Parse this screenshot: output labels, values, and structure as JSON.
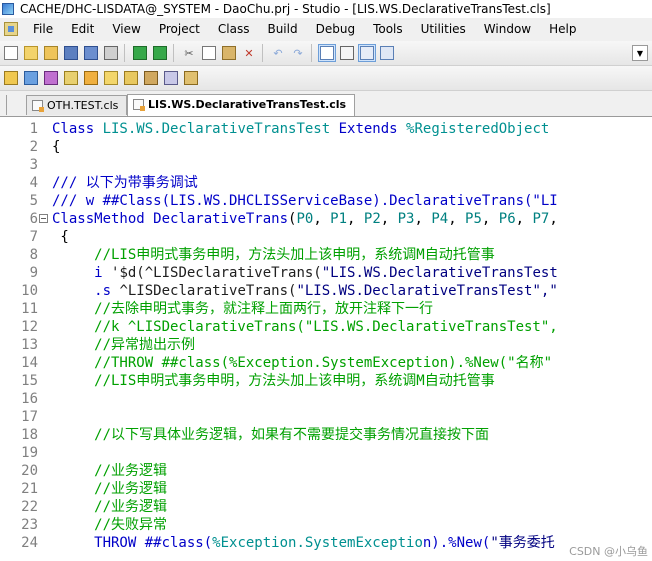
{
  "window": {
    "title": "CACHE/DHC-LISDATA@_SYSTEM - DaoChu.prj - Studio - [LIS.WS.DeclarativeTransTest.cls]"
  },
  "menu": [
    "File",
    "Edit",
    "View",
    "Project",
    "Class",
    "Build",
    "Debug",
    "Tools",
    "Utilities",
    "Window",
    "Help"
  ],
  "tabs": [
    {
      "label": "OTH.TEST.cls",
      "active": false
    },
    {
      "label": "LIS.WS.DeclarativeTransTest.cls",
      "active": true
    }
  ],
  "editor": {
    "lines": [
      {
        "n": "1",
        "fold": false,
        "segs": [
          {
            "t": "Class ",
            "c": "kw"
          },
          {
            "t": "LIS.WS.DeclarativeTransTest ",
            "c": "cls"
          },
          {
            "t": "Extends ",
            "c": "kw"
          },
          {
            "t": "%RegisteredObject",
            "c": "cls"
          }
        ]
      },
      {
        "n": "2",
        "fold": false,
        "segs": [
          {
            "t": "{",
            "c": "bl"
          }
        ]
      },
      {
        "n": "3",
        "fold": false,
        "segs": []
      },
      {
        "n": "4",
        "fold": false,
        "segs": [
          {
            "t": "/// 以下为带事务调试",
            "c": "kw"
          }
        ]
      },
      {
        "n": "5",
        "fold": false,
        "segs": [
          {
            "t": "/// w ##Class(LIS.WS.DHCLISServiceBase).DeclarativeTrans(\"LI",
            "c": "kw"
          }
        ]
      },
      {
        "n": "6",
        "fold": true,
        "segs": [
          {
            "t": "ClassMethod ",
            "c": "kw"
          },
          {
            "t": "DeclarativeTrans",
            "c": "kw"
          },
          {
            "t": "(",
            "c": "bl"
          },
          {
            "t": "P0",
            "c": "par"
          },
          {
            "t": ", ",
            "c": "bl"
          },
          {
            "t": "P1",
            "c": "par"
          },
          {
            "t": ", ",
            "c": "bl"
          },
          {
            "t": "P2",
            "c": "par"
          },
          {
            "t": ", ",
            "c": "bl"
          },
          {
            "t": "P3",
            "c": "par"
          },
          {
            "t": ", ",
            "c": "bl"
          },
          {
            "t": "P4",
            "c": "par"
          },
          {
            "t": ", ",
            "c": "bl"
          },
          {
            "t": "P5",
            "c": "par"
          },
          {
            "t": ", ",
            "c": "bl"
          },
          {
            "t": "P6",
            "c": "par"
          },
          {
            "t": ", ",
            "c": "bl"
          },
          {
            "t": "P7",
            "c": "par"
          },
          {
            "t": ",",
            "c": "bl"
          }
        ]
      },
      {
        "n": "7",
        "fold": false,
        "segs": [
          {
            "t": " {",
            "c": "bl"
          }
        ]
      },
      {
        "n": "8",
        "fold": false,
        "segs": [
          {
            "t": "     //LIS申明式事务申明，方法头加上该申明，系统调M自动托管事",
            "c": "cm"
          }
        ]
      },
      {
        "n": "9",
        "fold": false,
        "segs": [
          {
            "t": "     i ",
            "c": "kw"
          },
          {
            "t": "'$d(",
            "c": "dk"
          },
          {
            "t": "^LISDeclarativeTrans(",
            "c": "dk"
          },
          {
            "t": "\"LIS.WS.DeclarativeTransTest",
            "c": "str"
          }
        ]
      },
      {
        "n": "10",
        "fold": false,
        "segs": [
          {
            "t": "     .s ",
            "c": "kw"
          },
          {
            "t": "^LISDeclarativeTrans(",
            "c": "dk"
          },
          {
            "t": "\"LIS.WS.DeclarativeTransTest\",\"",
            "c": "str"
          }
        ]
      },
      {
        "n": "11",
        "fold": false,
        "segs": [
          {
            "t": "     //去除申明式事务，就注释上面两行，放开注释下一行",
            "c": "cm"
          }
        ]
      },
      {
        "n": "12",
        "fold": false,
        "segs": [
          {
            "t": "     //k ^LISDeclarativeTrans(\"LIS.WS.DeclarativeTransTest\",",
            "c": "cm"
          }
        ]
      },
      {
        "n": "13",
        "fold": false,
        "segs": [
          {
            "t": "     //异常抛出示例",
            "c": "cm"
          }
        ]
      },
      {
        "n": "14",
        "fold": false,
        "segs": [
          {
            "t": "     //THROW ##class(%Exception.SystemException).%New(\"名称\"",
            "c": "cm"
          }
        ]
      },
      {
        "n": "15",
        "fold": false,
        "segs": [
          {
            "t": "     //LIS申明式事务申明，方法头加上该申明，系统调M自动托管事",
            "c": "cm"
          }
        ]
      },
      {
        "n": "16",
        "fold": false,
        "segs": []
      },
      {
        "n": "17",
        "fold": false,
        "segs": []
      },
      {
        "n": "18",
        "fold": false,
        "segs": [
          {
            "t": "     //以下写具体业务逻辑，如果有不需要提交事务情况直接按下面",
            "c": "cm"
          }
        ]
      },
      {
        "n": "19",
        "fold": false,
        "segs": []
      },
      {
        "n": "20",
        "fold": false,
        "segs": [
          {
            "t": "     //业务逻辑",
            "c": "cm"
          }
        ]
      },
      {
        "n": "21",
        "fold": false,
        "segs": [
          {
            "t": "     //业务逻辑",
            "c": "cm"
          }
        ]
      },
      {
        "n": "22",
        "fold": false,
        "segs": [
          {
            "t": "     //业务逻辑",
            "c": "cm"
          }
        ]
      },
      {
        "n": "23",
        "fold": false,
        "segs": [
          {
            "t": "     //失败异常",
            "c": "cm"
          }
        ]
      },
      {
        "n": "24",
        "fold": false,
        "segs": [
          {
            "t": "     THROW ",
            "c": "kw"
          },
          {
            "t": "##class(",
            "c": "kw"
          },
          {
            "t": "%Exception.SystemExceptio",
            "c": "cls"
          },
          {
            "t": "n).%New(",
            "c": "kw"
          },
          {
            "t": "\"事务委托",
            "c": "str"
          }
        ]
      }
    ]
  },
  "watermark": "CSDN @小乌鱼"
}
